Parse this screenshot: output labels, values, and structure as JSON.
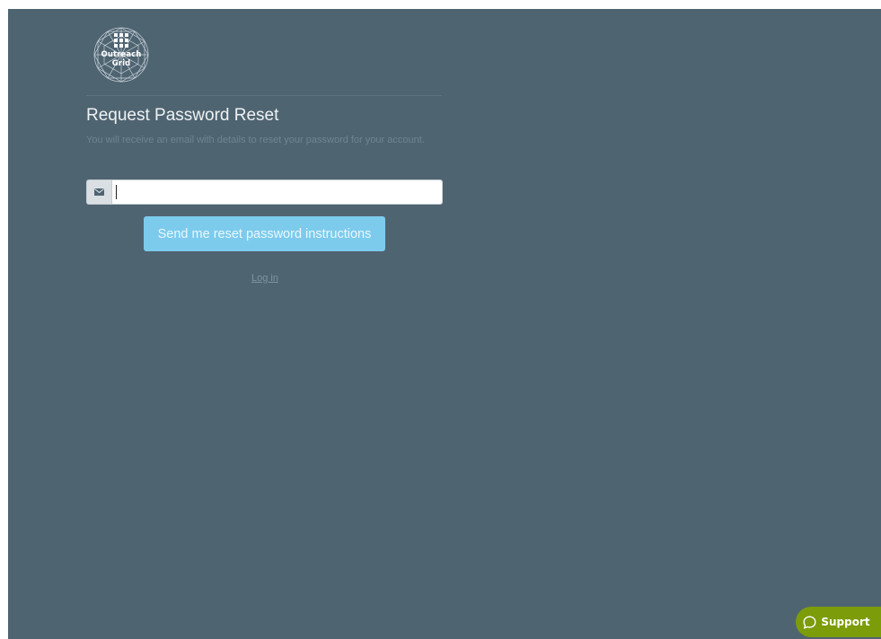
{
  "brand": {
    "name": "Outreach Grid",
    "colors": {
      "page_background": "#4f6471",
      "primary_button": "#7dcbec",
      "support_button": "#7c9c0a"
    }
  },
  "form": {
    "title": "Request Password Reset",
    "description": "You will receive an email with details to reset your password for your account.",
    "email": {
      "icon": "envelope-icon",
      "value": "",
      "placeholder": ""
    },
    "submit_label": "Send me reset password instructions",
    "login_link": "Log in"
  },
  "support": {
    "icon": "chat-bubble-icon",
    "label": "Support"
  }
}
